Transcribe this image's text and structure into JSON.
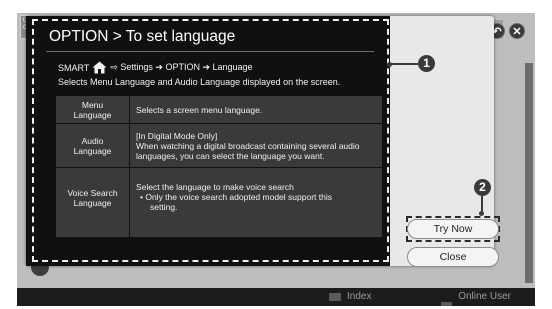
{
  "guide_badge": "User Guide",
  "top_buttons": {
    "back_icon": "↶",
    "close_icon": "✕"
  },
  "popup": {
    "title": "OPTION > To set language",
    "path_prefix": "SMART",
    "path_suffix": "⇨ Settings ➔ OPTION ➔ Language",
    "description": "Selects Menu Language and Audio Language displayed on the screen.",
    "rows": [
      {
        "key": "Menu\nLanguage",
        "value": "Selects a screen menu language."
      },
      {
        "key": "Audio\nLanguage",
        "value": "[In Digital Mode Only]\nWhen watching a digital broadcast containing several audio\nlanguages, you can select the language you want."
      },
      {
        "key": "Voice Search\nLanguage",
        "value": "Select the language to make voice search",
        "bullet": "• Only the voice search adopted model support this",
        "bullet_cont": "setting."
      }
    ],
    "try_now_label": "Try Now",
    "close_label": "Close"
  },
  "callouts": [
    "1",
    "2"
  ],
  "bottom_bar": {
    "index_label": "Index",
    "online_label": "Online User Guide"
  }
}
